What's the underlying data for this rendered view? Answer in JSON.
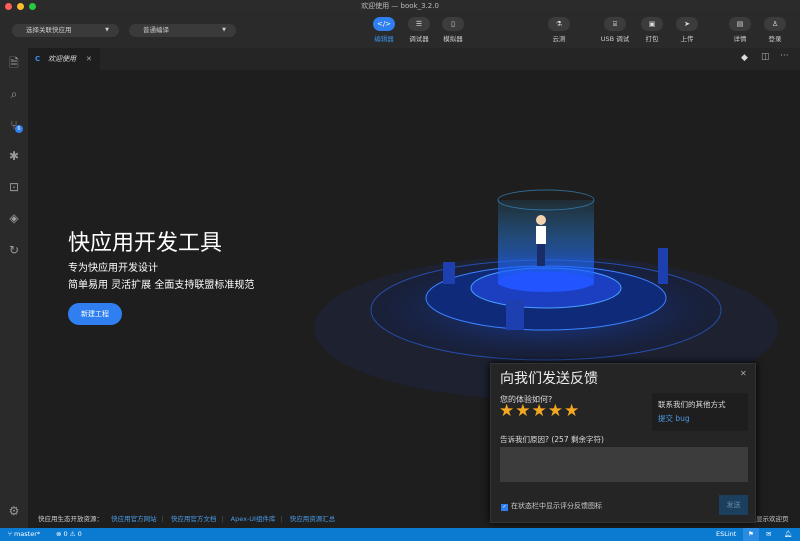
{
  "window": {
    "title": "欢迎使用 — book_3.2.0"
  },
  "toolbar": {
    "select_app": "选择关联快应用",
    "compile_mode": "普通编译",
    "buttons": [
      {
        "label": "编辑器",
        "icon": "code-icon",
        "active": true
      },
      {
        "label": "调试器",
        "icon": "sliders-icon"
      },
      {
        "label": "模拟器",
        "icon": "phone-icon"
      },
      {
        "label": "云测",
        "icon": "flask-icon"
      },
      {
        "label": "USB 调试",
        "icon": "usb-icon"
      },
      {
        "label": "打包",
        "icon": "package-icon"
      },
      {
        "label": "上传",
        "icon": "send-icon"
      },
      {
        "label": "详情",
        "icon": "document-icon"
      },
      {
        "label": "登录",
        "icon": "user-icon"
      }
    ]
  },
  "activity": {
    "scm_badge": "6"
  },
  "tab": {
    "label": "欢迎使用"
  },
  "welcome": {
    "title": "快应用开发工具",
    "subtitle1": "专为快应用开发设计",
    "subtitle2": "简单易用 灵活扩展 全面支持联盟标准规范",
    "new_project": "新建工程"
  },
  "resources": {
    "label": "快应用生态开放资源：",
    "links": [
      "快应用官方网站",
      "快应用官方文档",
      "Apex-UI组件库",
      "快应用资源汇总"
    ],
    "show_welcome": "显示欢迎页"
  },
  "feedback": {
    "title": "向我们发送反馈",
    "rating_question": "您的体验如何?",
    "rating": 5,
    "rating_max": 5,
    "contact_title": "联系我们的其他方式",
    "submit_bug": "提交 bug",
    "reason_label": "告诉我们原因? (257 剩余字符)",
    "reason_value": "",
    "show_in_status": "在状态栏中显示评分反馈图标",
    "show_in_status_checked": true,
    "send": "发送"
  },
  "status": {
    "branch": "master*",
    "errors": "0",
    "warnings": "0",
    "eslint": "ESLint"
  },
  "colors": {
    "accent": "#2f7ff0",
    "status_bar": "#0b7ad1",
    "star": "#f5a623"
  }
}
